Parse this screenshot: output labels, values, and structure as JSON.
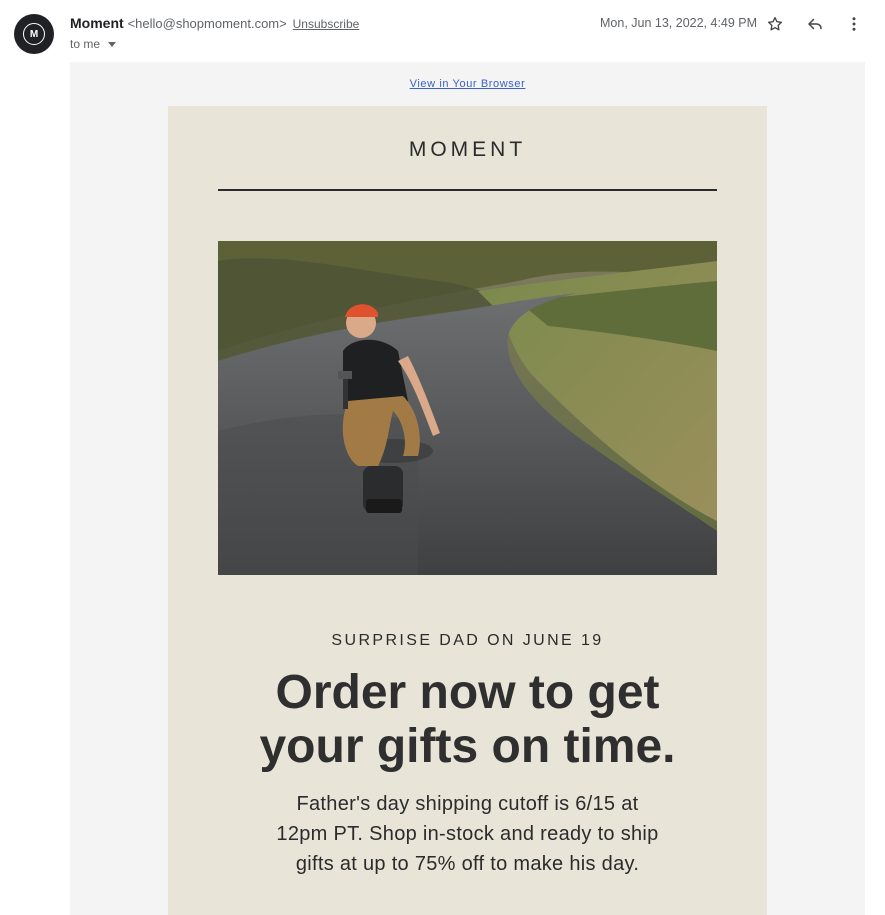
{
  "header": {
    "avatar_letter": "M",
    "sender_name": "Moment",
    "sender_email": "<hello@shopmoment.com>",
    "unsubscribe_label": "Unsubscribe",
    "recipient_label": "to me",
    "date": "Mon, Jun 13, 2022, 4:49 PM",
    "icons": [
      "star-icon",
      "reply-icon",
      "more-vert-icon"
    ]
  },
  "email": {
    "view_in_browser": "View in Your Browser",
    "logo_text": "MOMENT",
    "eyebrow": "SURPRISE DAD ON JUNE 19",
    "headline_line1": "Order now to get",
    "headline_line2": "your gifts on time.",
    "body": "Father's day shipping cutoff is 6/15 at 12pm PT. Shop in-stock and ready to ship gifts at up to 75% off to make his day.",
    "colors": {
      "card_background": "#e8e5d8",
      "outer_background": "#f4f4f4",
      "link": "#3b62c4",
      "text": "#2b2b2b"
    }
  }
}
